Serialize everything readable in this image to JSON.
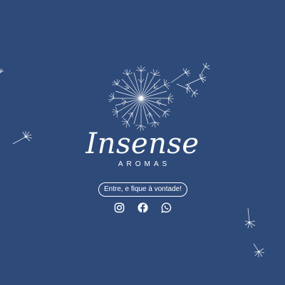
{
  "brand": {
    "name": "Insense",
    "subtitle": "AROMAS"
  },
  "cta": {
    "label": "Entre, e fique à vontade!"
  },
  "social": [
    {
      "network": "instagram",
      "icon": "instagram-icon"
    },
    {
      "network": "facebook",
      "icon": "facebook-icon"
    },
    {
      "network": "whatsapp",
      "icon": "whatsapp-icon"
    }
  ],
  "colors": {
    "background": "#2e4a79",
    "foreground": "#ffffff"
  }
}
